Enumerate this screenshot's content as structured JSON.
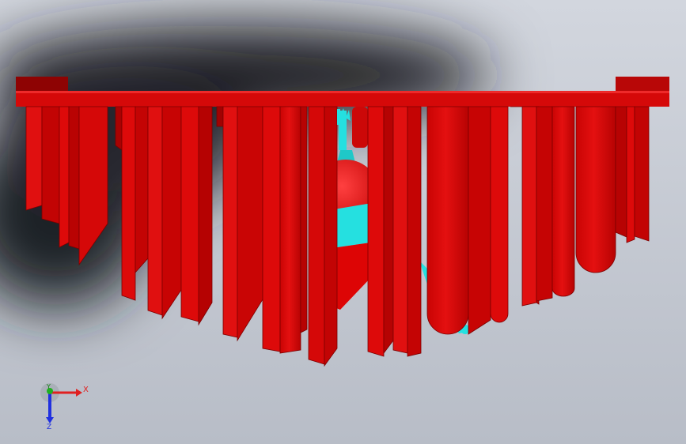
{
  "viewport": {
    "background_top": "#ced3db",
    "background_bottom": "#b9bec8",
    "shadow_color": "#1c1f24"
  },
  "model": {
    "primary_color": "#dd0a0a",
    "dark_color": "#8e0303",
    "light_color": "#ef2020",
    "secondary_color": "#25e0e0"
  },
  "triad": {
    "x_label": "X",
    "y_label": "Y",
    "z_label": "Z",
    "x_color": "#e02020",
    "y_color": "#20b020",
    "z_color": "#2030e0"
  }
}
